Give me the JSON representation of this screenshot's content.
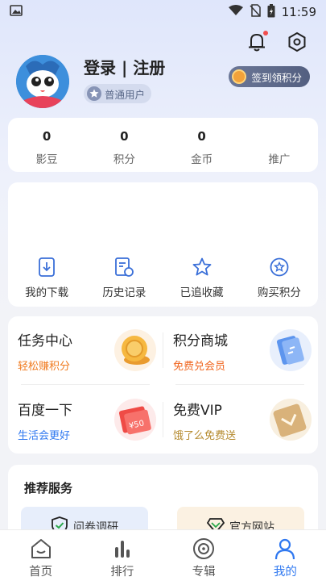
{
  "status_bar": {
    "time": "11:59"
  },
  "profile": {
    "title": "登录 | 注册",
    "level": "普通用户",
    "checkin_label": "签到领积分"
  },
  "stats": [
    {
      "value": "0",
      "label": "影豆"
    },
    {
      "value": "0",
      "label": "积分"
    },
    {
      "value": "0",
      "label": "金币"
    },
    {
      "value": "",
      "label": "推广"
    }
  ],
  "tools": [
    {
      "label": "我的下载",
      "icon": "download-icon"
    },
    {
      "label": "历史记录",
      "icon": "history-icon"
    },
    {
      "label": "已追收藏",
      "icon": "star-icon"
    },
    {
      "label": "购买积分",
      "icon": "buy-points-icon"
    }
  ],
  "tasks": [
    {
      "title": "任务中心",
      "subtitle": "轻松赚积分",
      "subtitle_color": "#f07a1e",
      "art": "gold-coin-icon"
    },
    {
      "title": "积分商城",
      "subtitle": "免费兑会员",
      "subtitle_color": "#f0651e",
      "art": "card-exchange-icon"
    },
    {
      "title": "百度一下",
      "subtitle": "生活会更好",
      "subtitle_color": "#2f78f0",
      "art": "coupon-icon"
    },
    {
      "title": "免费VIP",
      "subtitle": "饿了么免费送",
      "subtitle_color": "#b58a2e",
      "art": "vip-card-icon"
    }
  ],
  "coupon_text": "¥50",
  "services": {
    "title": "推荐服务",
    "items": [
      {
        "label": "问卷调研",
        "bg": "#e7eefb"
      },
      {
        "label": "官方网站",
        "bg": "#fbf1e2"
      }
    ]
  },
  "tabs": [
    {
      "label": "首页",
      "icon": "home-icon"
    },
    {
      "label": "排行",
      "icon": "ranking-icon"
    },
    {
      "label": "专辑",
      "icon": "album-icon"
    },
    {
      "label": "我的",
      "icon": "user-icon",
      "active": true
    }
  ],
  "colors": {
    "accent": "#2f78f0",
    "background": "#f2f3f7"
  }
}
